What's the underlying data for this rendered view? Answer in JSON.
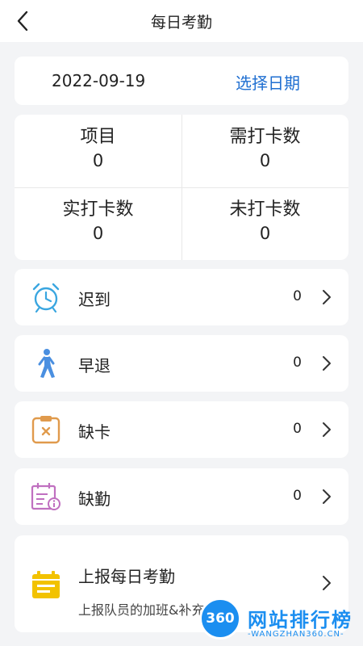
{
  "header": {
    "title": "每日考勤"
  },
  "date_bar": {
    "date": "2022-09-19",
    "pick_label": "选择日期"
  },
  "stats": [
    {
      "label": "项目",
      "value": "0"
    },
    {
      "label": "需打卡数",
      "value": "0"
    },
    {
      "label": "实打卡数",
      "value": "0"
    },
    {
      "label": "未打卡数",
      "value": "0"
    }
  ],
  "rows": [
    {
      "label": "迟到",
      "count": "0",
      "icon": "alarm-clock-icon",
      "color": "#3aa6e0"
    },
    {
      "label": "早退",
      "count": "0",
      "icon": "walking-person-icon",
      "color": "#4a8fe0"
    },
    {
      "label": "缺卡",
      "count": "0",
      "icon": "clipboard-x-icon",
      "color": "#e09a4c"
    },
    {
      "label": "缺勤",
      "count": "0",
      "icon": "calendar-info-icon",
      "color": "#c070c0"
    }
  ],
  "report": {
    "title": "上报每日考勤",
    "subtitle": "上报队员的加班&补充信息",
    "icon": "calendar-report-icon",
    "color": "#f2c200"
  },
  "watermark": {
    "circle": "360",
    "title": "网站排行榜",
    "domain": "-WANGZHAN360.CN-"
  },
  "colors": {
    "link": "#1f6fd1",
    "background": "#f3f4f6"
  }
}
